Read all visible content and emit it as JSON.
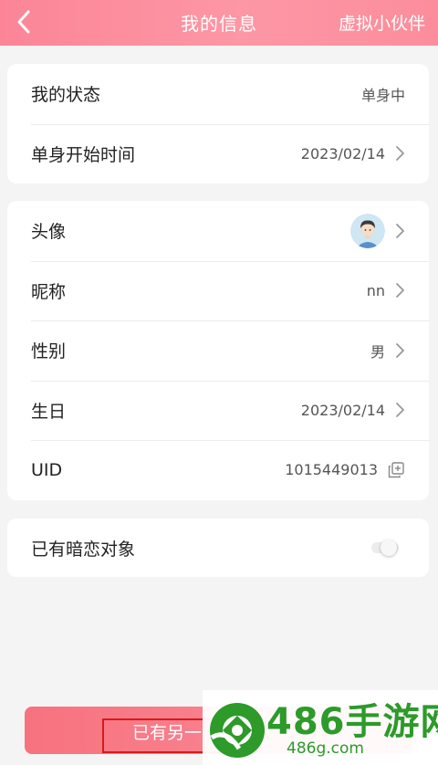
{
  "header": {
    "title": "我的信息",
    "action": "虚拟小伙伴"
  },
  "status_card": {
    "rows": [
      {
        "label": "我的状态",
        "value": "单身中"
      },
      {
        "label": "单身开始时间",
        "value": "2023/02/14"
      }
    ]
  },
  "profile_card": {
    "rows": [
      {
        "label": "头像"
      },
      {
        "label": "昵称",
        "value": "nn"
      },
      {
        "label": "性别",
        "value": "男"
      },
      {
        "label": "生日",
        "value": "2023/02/14"
      },
      {
        "label": "UID",
        "value": "1015449013"
      }
    ]
  },
  "crush_card": {
    "label": "已有暗恋对象",
    "toggle_on": false
  },
  "bottom_button": {
    "label": "已有另一"
  },
  "watermark": {
    "title": "486手游网",
    "url": "486g.com"
  },
  "colors": {
    "header": "#fd97a5",
    "button": "#f7727f",
    "highlight": "#d61a1a",
    "watermark": "#2d9a2a"
  }
}
